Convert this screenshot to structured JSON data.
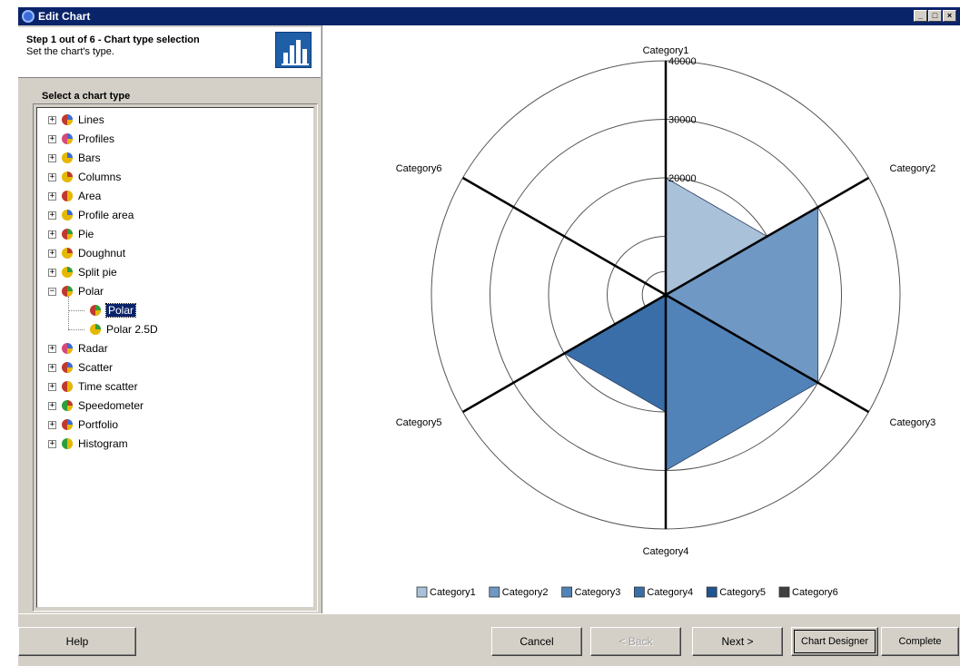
{
  "window": {
    "title": "Edit Chart",
    "buttons": [
      "_",
      "□",
      "×"
    ]
  },
  "wizard": {
    "step_title": "Step 1 out of 6 - Chart type selection",
    "step_subtitle": "Set the chart's type.",
    "step_icon": "column-chart-icon"
  },
  "tree": {
    "header": "Select a chart type",
    "items": [
      {
        "label": "Lines",
        "icon": "lines-chart-icon",
        "expander": "+"
      },
      {
        "label": "Profiles",
        "icon": "profiles-chart-icon",
        "expander": "+"
      },
      {
        "label": "Bars",
        "icon": "bars-chart-icon",
        "expander": "+"
      },
      {
        "label": "Columns",
        "icon": "columns-chart-icon",
        "expander": "+"
      },
      {
        "label": "Area",
        "icon": "area-chart-icon",
        "expander": "+"
      },
      {
        "label": "Profile area",
        "icon": "profile-area-chart-icon",
        "expander": "+"
      },
      {
        "label": "Pie",
        "icon": "pie-chart-icon",
        "expander": "+"
      },
      {
        "label": "Doughnut",
        "icon": "doughnut-chart-icon",
        "expander": "+"
      },
      {
        "label": "Split pie",
        "icon": "split-pie-chart-icon",
        "expander": "+"
      },
      {
        "label": "Polar",
        "icon": "polar-chart-icon",
        "expander": "−"
      },
      {
        "label": "Polar",
        "icon": "polar-chart-icon",
        "child": true,
        "selected": true
      },
      {
        "label": "Polar 2.5D",
        "icon": "polar-25d-chart-icon",
        "child": true
      },
      {
        "label": "Radar",
        "icon": "radar-chart-icon",
        "expander": "+"
      },
      {
        "label": "Scatter",
        "icon": "scatter-chart-icon",
        "expander": "+"
      },
      {
        "label": "Time scatter",
        "icon": "time-scatter-chart-icon",
        "expander": "+"
      },
      {
        "label": "Speedometer",
        "icon": "speedometer-chart-icon",
        "expander": "+"
      },
      {
        "label": "Portfolio",
        "icon": "portfolio-chart-icon",
        "expander": "+"
      },
      {
        "label": "Histogram",
        "icon": "histogram-chart-icon",
        "expander": "+"
      }
    ]
  },
  "chart_data": {
    "type": "polar",
    "categories": [
      "Category1",
      "Category2",
      "Category3",
      "Category4",
      "Category5",
      "Category6"
    ],
    "values": [
      20000,
      30000,
      30000,
      20000,
      0,
      0
    ],
    "radial_ticks": [
      20000,
      30000,
      40000
    ],
    "rmax": 40000,
    "legend": [
      "Category1",
      "Category2",
      "Category3",
      "Category4",
      "Category5",
      "Category6"
    ],
    "legend_position": "bottom",
    "colors": [
      "#a9c1d9",
      "#6f98c4",
      "#5283b8",
      "#3a6ea8",
      "#1f548f",
      "#404040"
    ]
  },
  "buttons": {
    "help": "Help",
    "cancel": "Cancel",
    "back": "< Back",
    "next": "Next >",
    "chart_designer": "Chart Designer",
    "complete": "Complete"
  }
}
